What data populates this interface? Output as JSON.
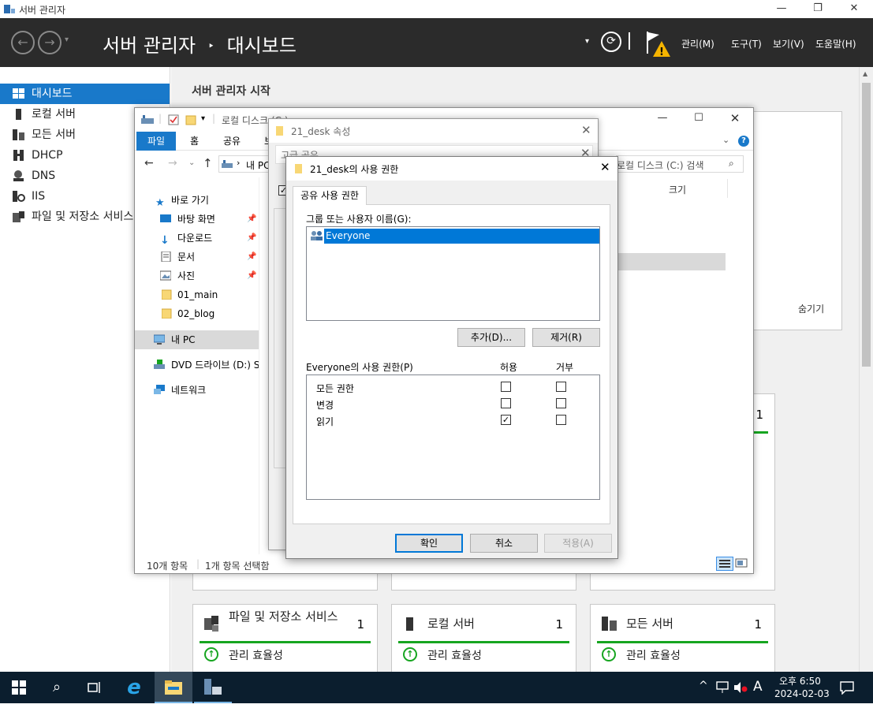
{
  "server_manager": {
    "window_title": "서버 관리자",
    "breadcrumb_app": "서버 관리자",
    "breadcrumb_sep": "‣",
    "breadcrumb_page": "대시보드",
    "menu": [
      "관리(M)",
      "도구(T)",
      "보기(V)",
      "도움말(H)"
    ],
    "sidebar": [
      {
        "label": "대시보드",
        "icon": "dashboard-icon"
      },
      {
        "label": "로컬 서버",
        "icon": "server-icon"
      },
      {
        "label": "모든 서버",
        "icon": "servers-icon"
      },
      {
        "label": "DHCP",
        "icon": "dhcp-icon"
      },
      {
        "label": "DNS",
        "icon": "dns-icon"
      },
      {
        "label": "IIS",
        "icon": "iis-icon"
      },
      {
        "label": "파일 및 저장소 서비스",
        "icon": "storage-icon"
      }
    ],
    "main_heading": "서버 관리자 시작",
    "hide_label": "숨기기",
    "tiles": [
      {
        "name": "파일 및 저장소 서비스",
        "count": "1",
        "status": "관리 효율성"
      },
      {
        "name": "로컬 서버",
        "count": "1",
        "status": "관리 효율성"
      },
      {
        "name": "모든 서버",
        "count": "1",
        "status": "관리 효율성"
      }
    ],
    "upper_tile_count": "1",
    "status_color": "#16a520"
  },
  "explorer": {
    "title_path": "로컬 디스크 (C:)",
    "ribbon_tabs": [
      "파일",
      "홈",
      "공유",
      "보기"
    ],
    "address": "내 PC",
    "search_placeholder": "로컬 디스크 (C:) 검색",
    "column_size": "크기",
    "nav": {
      "quick_access": "바로 가기",
      "desktop": "바탕 화면",
      "downloads": "다운로드",
      "documents": "문서",
      "pictures": "사진",
      "folder1": "01_main",
      "folder2": "02_blog",
      "this_pc": "내 PC",
      "dvd": "DVD 드라이브 (D:) S",
      "network": "네트워크"
    },
    "status_items": "10개 항목",
    "status_selected": "1개 항목 선택함"
  },
  "properties": {
    "title": "21_desk 속성",
    "tab_partial": "고급 공유"
  },
  "permissions": {
    "title": "21_desk의 사용 권한",
    "tab": "공유 사용 권한",
    "group_label": "그룹 또는 사용자 이름(G):",
    "users": [
      "Everyone"
    ],
    "add_button": "추가(D)...",
    "remove_button": "제거(R)",
    "perm_label": "Everyone의 사용 권한(P)",
    "allow_col": "허용",
    "deny_col": "거부",
    "rows": [
      {
        "name": "모든 권한",
        "allow": false,
        "deny": false
      },
      {
        "name": "변경",
        "allow": false,
        "deny": false
      },
      {
        "name": "읽기",
        "allow": true,
        "deny": false
      }
    ],
    "ok_button": "확인",
    "cancel_button": "취소",
    "apply_button": "적용(A)"
  },
  "taskbar": {
    "ime": "A",
    "time": "오후 6:50",
    "date": "2024-02-03"
  }
}
